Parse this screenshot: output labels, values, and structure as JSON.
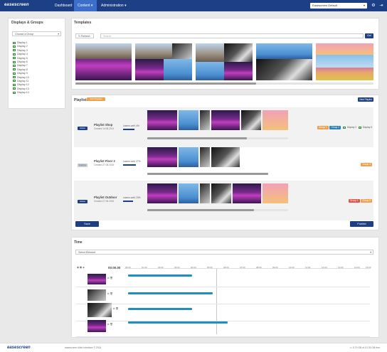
{
  "topbar": {
    "logo": "easescreen",
    "nav": [
      "Dashboard",
      "Content ▾",
      "Administration ▾"
    ],
    "instance_select": "Easescreen Default",
    "gear_icon": "gear-icon",
    "logout_icon": "logout-icon"
  },
  "displays": {
    "title": "Displays & Groups",
    "group_select": "Choose a Group",
    "items": [
      "Display 1",
      "Display 2",
      "Display 3",
      "Display 4",
      "Display 5",
      "Display 6",
      "Display 7",
      "Display 8",
      "Display 9",
      "Display 10",
      "Display 11",
      "Display 12",
      "Display 13",
      "Display 14"
    ]
  },
  "templates": {
    "title": "Templates",
    "refresh": "Refresh",
    "search_placeholder": "Search",
    "go": "Go!"
  },
  "playlists": {
    "title": "Playlists",
    "badge": "Edit Playlists",
    "new_button": "New Playlist",
    "items": [
      {
        "status": "Active",
        "name": "Playlist Shop",
        "created": "Created 14.08.2014",
        "learn": "Learns until: 4%",
        "tags": [
          "Group 1",
          "Group 2"
        ],
        "displays": [
          "Display 3",
          "Display 6"
        ]
      },
      {
        "status": "Inactive",
        "name": "Playlist Floor 2",
        "created": "Created 27.05.2015",
        "learn": "Learns until: 27%",
        "tags": [
          "Group 4"
        ],
        "displays": []
      },
      {
        "status": "Active",
        "name": "Playlist Outdoor",
        "created": "Created 27.05.2015",
        "learn": "Learns until: 23%",
        "tags": [
          "Group 1",
          "Group 5"
        ],
        "displays": []
      }
    ],
    "save": "Save",
    "publish": "Publish"
  },
  "time": {
    "title": "Time",
    "select": "Select Element",
    "current": "00:00.00",
    "ticks": [
      "00:00",
      "01:00",
      "02:00",
      "03:00",
      "04:00",
      "05:00",
      "06:00",
      "07:00",
      "08:00",
      "09:00",
      "10:00",
      "11:00",
      "12:00",
      "13:00",
      "14:00",
      "15:00"
    ]
  },
  "footer": {
    "logo": "easescreen",
    "copyright": "easescreen Web Interface © 2014",
    "storage": "5.79 GB of 10.25 GB free"
  }
}
